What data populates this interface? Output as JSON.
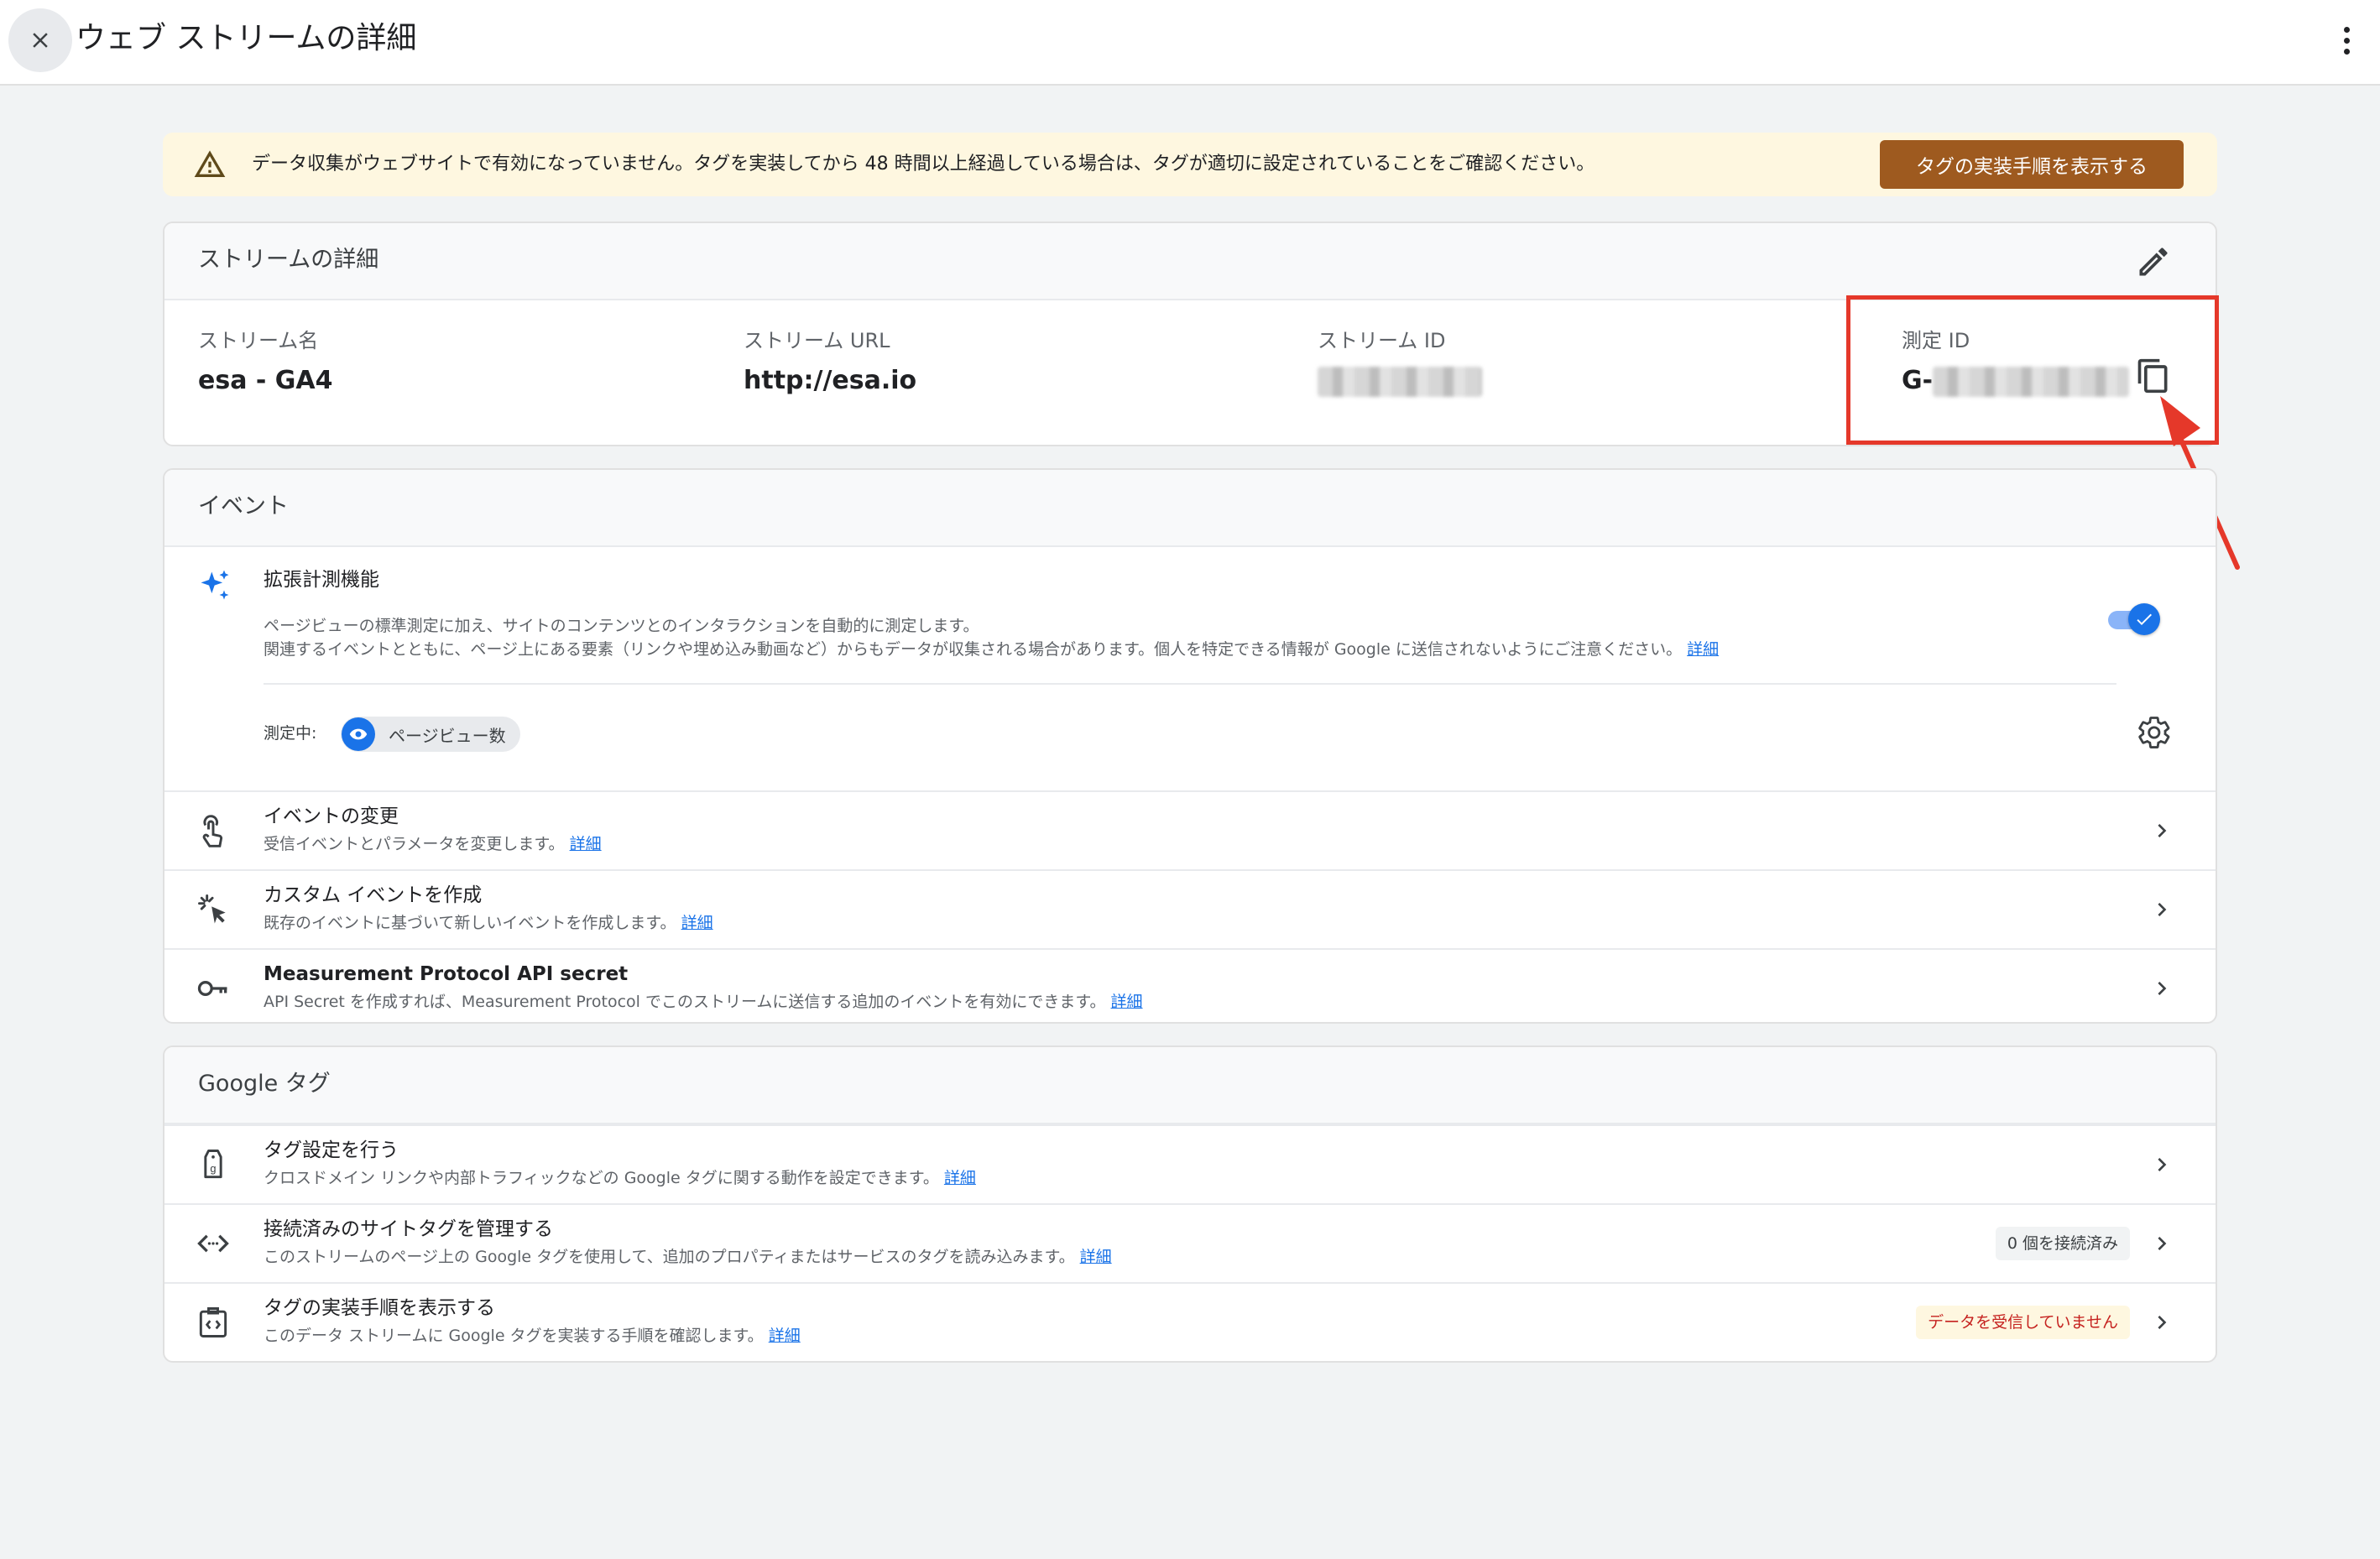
{
  "header": {
    "title": "ウェブ ストリームの詳細",
    "close_icon": "close-icon",
    "more_icon": "more-vert-icon"
  },
  "banner": {
    "text": "データ収集がウェブサイトで有効になっていません。タグを実装してから 48 時間以上経過している場合は、タグが適切に設定されていることをご確認ください。",
    "button_label": "タグの実装手順を表示する",
    "icon": "warning-icon",
    "bg_color": "#fef7e0",
    "button_color": "#9e5a1f"
  },
  "stream_details": {
    "heading": "ストリームの詳細",
    "fields": [
      {
        "label": "ストリーム名",
        "value": "esa - GA4"
      },
      {
        "label": "ストリーム URL",
        "value": "http://esa.io"
      },
      {
        "label": "ストリーム ID",
        "value": ""
      },
      {
        "label": "測定 ID",
        "value": "G-"
      }
    ]
  },
  "events": {
    "heading": "イベント",
    "enhanced": {
      "title": "拡張計測機能",
      "desc1": "ページビューの標準測定に加え、サイトのコンテンツとのインタラクションを自動的に測定します。",
      "desc2": "関連するイベントとともに、ページ上にある要素（リンクや埋め込み動画など）からもデータが収集される場合があります。個人を特定できる情報が Google に送信されないようにご注意ください。",
      "link": "詳細",
      "measuring_label": "測定中:",
      "chip_label": "ページビュー数",
      "enabled": true
    },
    "rows": [
      {
        "title": "イベントの変更",
        "sub": "受信イベントとパラメータを変更します。",
        "link": "詳細",
        "icon": "touch-icon"
      },
      {
        "title": "カスタム イベントを作成",
        "sub": "既存のイベントに基づいて新しいイベントを作成します。",
        "link": "詳細",
        "icon": "click-sparkle-icon"
      },
      {
        "title": "Measurement Protocol API secret",
        "sub": "API Secret を作成すれば、Measurement Protocol でこのストリームに送信する追加のイベントを有効にできます。",
        "link": "詳細",
        "icon": "key-icon"
      }
    ]
  },
  "google_tag": {
    "heading": "Google タグ",
    "rows": [
      {
        "title": "タグ設定を行う",
        "sub": "クロスドメイン リンクや内部トラフィックなどの Google タグに関する動作を設定できます。",
        "link": "詳細",
        "icon": "tag-icon",
        "badge": ""
      },
      {
        "title": "接続済みのサイトタグを管理する",
        "sub": "このストリームのページ上の Google タグを使用して、追加のプロパティまたはサービスのタグを読み込みます。",
        "link": "詳細",
        "icon": "code-icon",
        "badge": "0 個を接続済み"
      },
      {
        "title": "タグの実装手順を表示する",
        "sub": "このデータ ストリームに Google タグを実装する手順を確認します。",
        "link": "詳細",
        "icon": "code-doc-icon",
        "badge": "データを受信していません"
      }
    ]
  }
}
